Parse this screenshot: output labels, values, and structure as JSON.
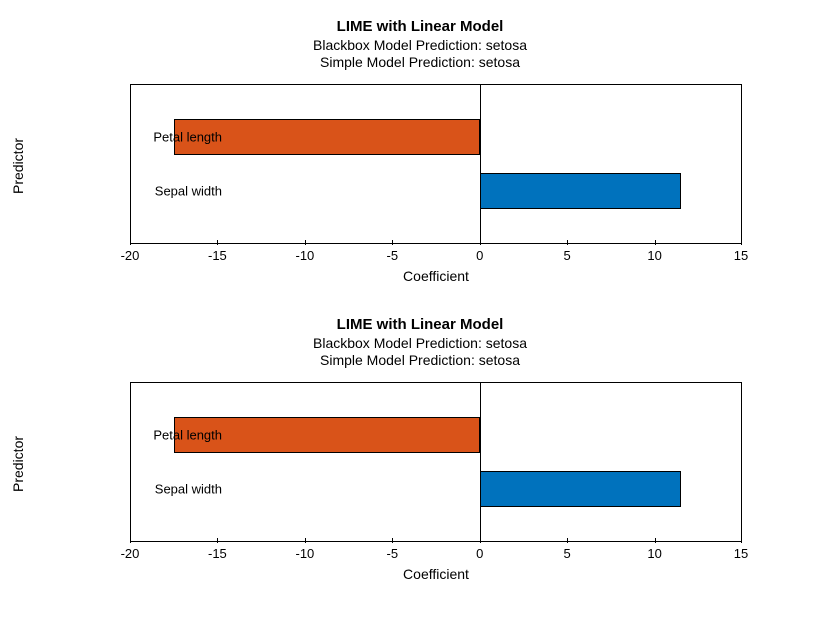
{
  "chart_data": [
    {
      "type": "bar",
      "orientation": "horizontal",
      "title": "LIME with Linear Model",
      "subtitle1": "Blackbox Model Prediction: setosa",
      "subtitle2": "Simple Model Prediction: setosa",
      "xlabel": "Coefficient",
      "ylabel": "Predictor",
      "xlim": [
        -20,
        15
      ],
      "xticks": [
        -20,
        -15,
        -10,
        -5,
        0,
        5,
        10,
        15
      ],
      "categories": [
        "Petal length",
        "Sepal width"
      ],
      "values": [
        -17.5,
        11.5
      ],
      "colors": [
        "#d95319",
        "#0072bd"
      ]
    },
    {
      "type": "bar",
      "orientation": "horizontal",
      "title": "LIME with Linear Model",
      "subtitle1": "Blackbox Model Prediction: setosa",
      "subtitle2": "Simple Model Prediction: setosa",
      "xlabel": "Coefficient",
      "ylabel": "Predictor",
      "xlim": [
        -20,
        15
      ],
      "xticks": [
        -20,
        -15,
        -10,
        -5,
        0,
        5,
        10,
        15
      ],
      "categories": [
        "Petal length",
        "Sepal width"
      ],
      "values": [
        -17.5,
        11.5
      ],
      "colors": [
        "#d95319",
        "#0072bd"
      ]
    }
  ]
}
